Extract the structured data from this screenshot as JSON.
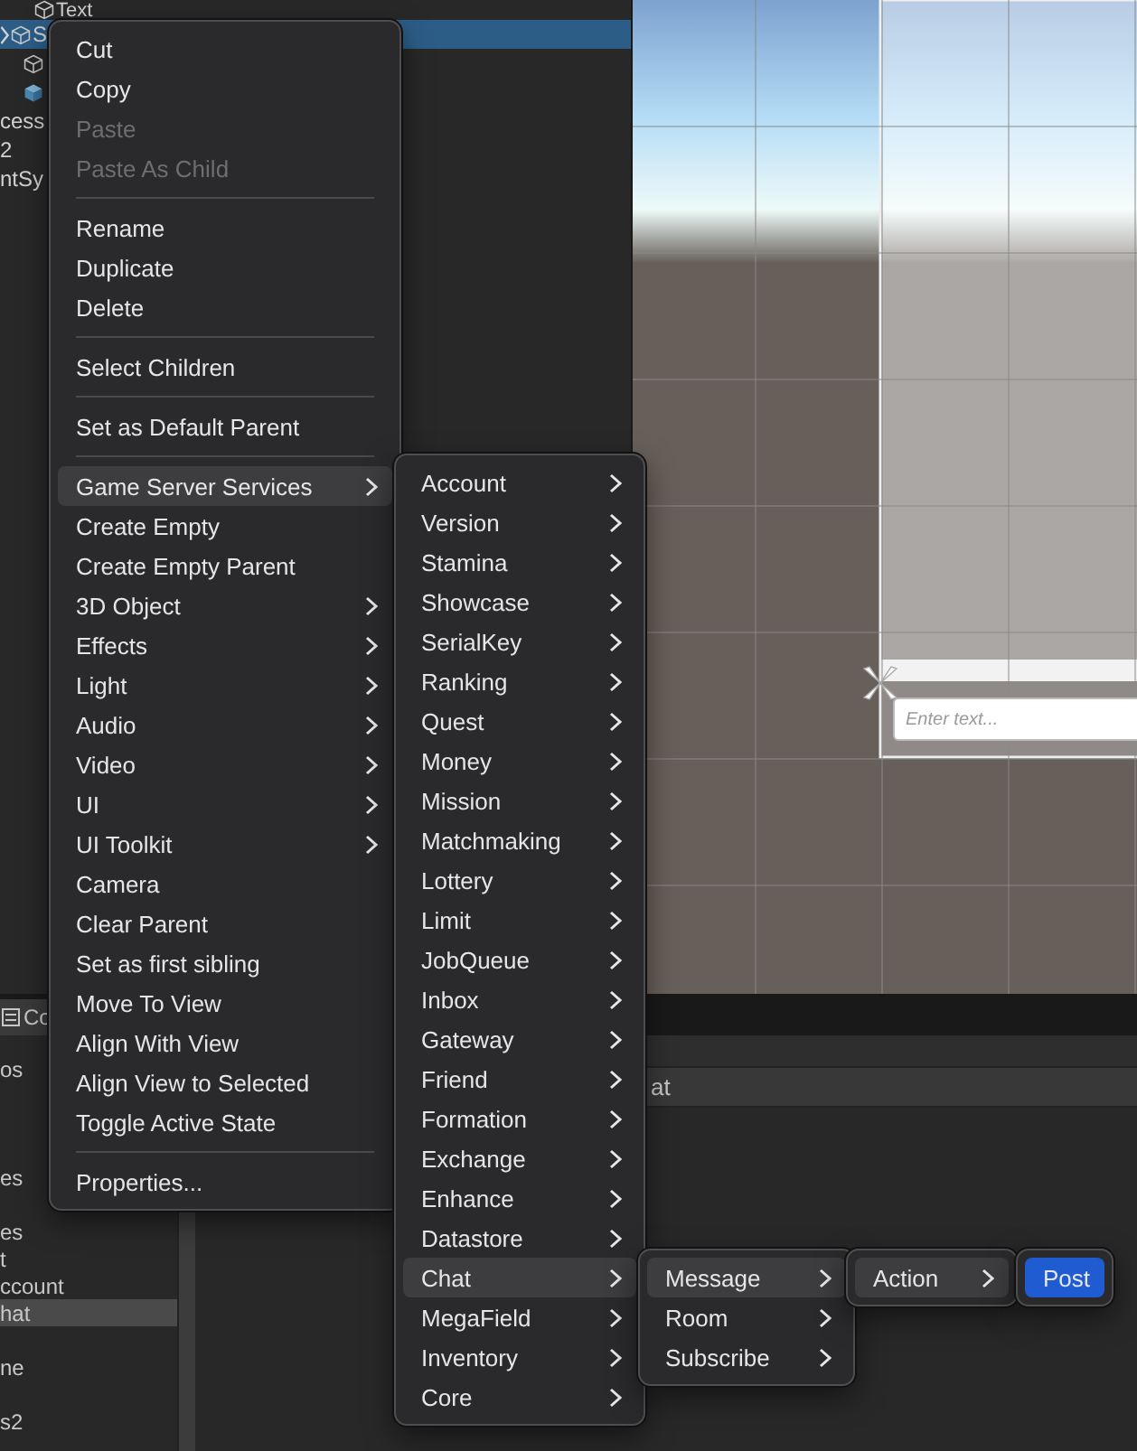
{
  "hierarchy": {
    "rows": [
      {
        "kind": "object",
        "label": "Text",
        "selected": false
      },
      {
        "kind": "object",
        "label": "S",
        "selected": true,
        "expandable": true
      },
      {
        "kind": "object",
        "selected": false
      },
      {
        "kind": "prefab",
        "selected": false
      },
      {
        "kind": "plain",
        "label": "cess",
        "selected": false
      },
      {
        "kind": "plain",
        "label": "2",
        "selected": false
      },
      {
        "kind": "plain",
        "label": "ntSy",
        "selected": false
      }
    ]
  },
  "scene": {
    "input_placeholder": "Enter text..."
  },
  "bottom_panel": {
    "tab": "Co",
    "list": [
      {
        "label": "os",
        "selected": false
      },
      {
        "label": "es",
        "selected": false
      },
      {
        "label": "es",
        "selected": false
      },
      {
        "label": "t",
        "selected": false
      },
      {
        "label": "ccount",
        "selected": false
      },
      {
        "label": "hat",
        "selected": true
      },
      {
        "label": "ne",
        "selected": false
      },
      {
        "label": "s2",
        "selected": false
      }
    ],
    "row_text": "at"
  },
  "menus": [
    {
      "active": false,
      "items": [
        {
          "kind": "item",
          "label": "Cut",
          "disabled": false,
          "submenu": false,
          "selected": false
        },
        {
          "kind": "item",
          "label": "Copy",
          "disabled": false,
          "submenu": false,
          "selected": false
        },
        {
          "kind": "item",
          "label": "Paste",
          "disabled": true,
          "submenu": false,
          "selected": false
        },
        {
          "kind": "item",
          "label": "Paste As Child",
          "disabled": true,
          "submenu": false,
          "selected": false
        },
        {
          "kind": "separator"
        },
        {
          "kind": "item",
          "label": "Rename",
          "disabled": false,
          "submenu": false,
          "selected": false
        },
        {
          "kind": "item",
          "label": "Duplicate",
          "disabled": false,
          "submenu": false,
          "selected": false
        },
        {
          "kind": "item",
          "label": "Delete",
          "disabled": false,
          "submenu": false,
          "selected": false
        },
        {
          "kind": "separator"
        },
        {
          "kind": "item",
          "label": "Select Children",
          "disabled": false,
          "submenu": false,
          "selected": false
        },
        {
          "kind": "separator"
        },
        {
          "kind": "item",
          "label": "Set as Default Parent",
          "disabled": false,
          "submenu": false,
          "selected": false
        },
        {
          "kind": "separator"
        },
        {
          "kind": "item",
          "label": "Game Server Services",
          "disabled": false,
          "submenu": true,
          "selected": true
        },
        {
          "kind": "item",
          "label": "Create Empty",
          "disabled": false,
          "submenu": false,
          "selected": false
        },
        {
          "kind": "item",
          "label": "Create Empty Parent",
          "disabled": false,
          "submenu": false,
          "selected": false
        },
        {
          "kind": "item",
          "label": "3D Object",
          "disabled": false,
          "submenu": true,
          "selected": false
        },
        {
          "kind": "item",
          "label": "Effects",
          "disabled": false,
          "submenu": true,
          "selected": false
        },
        {
          "kind": "item",
          "label": "Light",
          "disabled": false,
          "submenu": true,
          "selected": false
        },
        {
          "kind": "item",
          "label": "Audio",
          "disabled": false,
          "submenu": true,
          "selected": false
        },
        {
          "kind": "item",
          "label": "Video",
          "disabled": false,
          "submenu": true,
          "selected": false
        },
        {
          "kind": "item",
          "label": "UI",
          "disabled": false,
          "submenu": true,
          "selected": false
        },
        {
          "kind": "item",
          "label": "UI Toolkit",
          "disabled": false,
          "submenu": true,
          "selected": false
        },
        {
          "kind": "item",
          "label": "Camera",
          "disabled": false,
          "submenu": false,
          "selected": false
        },
        {
          "kind": "item",
          "label": "Clear Parent",
          "disabled": false,
          "submenu": false,
          "selected": false
        },
        {
          "kind": "item",
          "label": "Set as first sibling",
          "disabled": false,
          "submenu": false,
          "selected": false
        },
        {
          "kind": "item",
          "label": "Move To View",
          "disabled": false,
          "submenu": false,
          "selected": false
        },
        {
          "kind": "item",
          "label": "Align With View",
          "disabled": false,
          "submenu": false,
          "selected": false
        },
        {
          "kind": "item",
          "label": "Align View to Selected",
          "disabled": false,
          "submenu": false,
          "selected": false
        },
        {
          "kind": "item",
          "label": "Toggle Active State",
          "disabled": false,
          "submenu": false,
          "selected": false
        },
        {
          "kind": "separator"
        },
        {
          "kind": "item",
          "label": "Properties...",
          "disabled": false,
          "submenu": false,
          "selected": false
        }
      ]
    },
    {
      "active": false,
      "items": [
        {
          "kind": "item",
          "label": "Account",
          "disabled": false,
          "submenu": true,
          "selected": false
        },
        {
          "kind": "item",
          "label": "Version",
          "disabled": false,
          "submenu": true,
          "selected": false
        },
        {
          "kind": "item",
          "label": "Stamina",
          "disabled": false,
          "submenu": true,
          "selected": false
        },
        {
          "kind": "item",
          "label": "Showcase",
          "disabled": false,
          "submenu": true,
          "selected": false
        },
        {
          "kind": "item",
          "label": "SerialKey",
          "disabled": false,
          "submenu": true,
          "selected": false
        },
        {
          "kind": "item",
          "label": "Ranking",
          "disabled": false,
          "submenu": true,
          "selected": false
        },
        {
          "kind": "item",
          "label": "Quest",
          "disabled": false,
          "submenu": true,
          "selected": false
        },
        {
          "kind": "item",
          "label": "Money",
          "disabled": false,
          "submenu": true,
          "selected": false
        },
        {
          "kind": "item",
          "label": "Mission",
          "disabled": false,
          "submenu": true,
          "selected": false
        },
        {
          "kind": "item",
          "label": "Matchmaking",
          "disabled": false,
          "submenu": true,
          "selected": false
        },
        {
          "kind": "item",
          "label": "Lottery",
          "disabled": false,
          "submenu": true,
          "selected": false
        },
        {
          "kind": "item",
          "label": "Limit",
          "disabled": false,
          "submenu": true,
          "selected": false
        },
        {
          "kind": "item",
          "label": "JobQueue",
          "disabled": false,
          "submenu": true,
          "selected": false
        },
        {
          "kind": "item",
          "label": "Inbox",
          "disabled": false,
          "submenu": true,
          "selected": false
        },
        {
          "kind": "item",
          "label": "Gateway",
          "disabled": false,
          "submenu": true,
          "selected": false
        },
        {
          "kind": "item",
          "label": "Friend",
          "disabled": false,
          "submenu": true,
          "selected": false
        },
        {
          "kind": "item",
          "label": "Formation",
          "disabled": false,
          "submenu": true,
          "selected": false
        },
        {
          "kind": "item",
          "label": "Exchange",
          "disabled": false,
          "submenu": true,
          "selected": false
        },
        {
          "kind": "item",
          "label": "Enhance",
          "disabled": false,
          "submenu": true,
          "selected": false
        },
        {
          "kind": "item",
          "label": "Datastore",
          "disabled": false,
          "submenu": true,
          "selected": false
        },
        {
          "kind": "item",
          "label": "Chat",
          "disabled": false,
          "submenu": true,
          "selected": true
        },
        {
          "kind": "item",
          "label": "MegaField",
          "disabled": false,
          "submenu": true,
          "selected": false
        },
        {
          "kind": "item",
          "label": "Inventory",
          "disabled": false,
          "submenu": true,
          "selected": false
        },
        {
          "kind": "item",
          "label": "Core",
          "disabled": false,
          "submenu": true,
          "selected": false
        }
      ]
    },
    {
      "active": false,
      "items": [
        {
          "kind": "item",
          "label": "Message",
          "disabled": false,
          "submenu": true,
          "selected": true
        },
        {
          "kind": "item",
          "label": "Room",
          "disabled": false,
          "submenu": true,
          "selected": false
        },
        {
          "kind": "item",
          "label": "Subscribe",
          "disabled": false,
          "submenu": true,
          "selected": false
        }
      ]
    },
    {
      "active": false,
      "items": [
        {
          "kind": "item",
          "label": "Action",
          "disabled": false,
          "submenu": true,
          "selected": true
        }
      ]
    },
    {
      "active": true,
      "items": [
        {
          "kind": "item",
          "label": "Post",
          "disabled": false,
          "submenu": false,
          "selected": true
        }
      ]
    }
  ]
}
